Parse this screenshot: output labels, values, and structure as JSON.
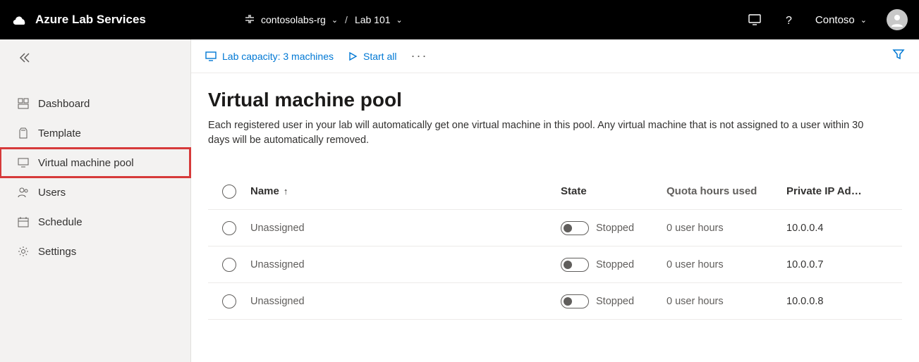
{
  "header": {
    "product": "Azure Lab Services",
    "resource_group": "contosolabs-rg",
    "lab_name": "Lab 101",
    "user_label": "Contoso"
  },
  "sidebar": {
    "items": [
      {
        "id": "dashboard",
        "label": "Dashboard"
      },
      {
        "id": "template",
        "label": "Template"
      },
      {
        "id": "vmpool",
        "label": "Virtual machine pool",
        "selected": true
      },
      {
        "id": "users",
        "label": "Users"
      },
      {
        "id": "schedule",
        "label": "Schedule"
      },
      {
        "id": "settings",
        "label": "Settings"
      }
    ]
  },
  "toolbar": {
    "capacity_label": "Lab capacity: 3 machines",
    "start_all_label": "Start all"
  },
  "page": {
    "title": "Virtual machine pool",
    "description": "Each registered user in your lab will automatically get one virtual machine in this pool. Any virtual machine that is not assigned to a user within 30 days will be automatically removed."
  },
  "table": {
    "columns": {
      "name": "Name",
      "state": "State",
      "quota": "Quota hours used",
      "ip": "Private IP Ad…"
    },
    "rows": [
      {
        "name": "Unassigned",
        "state": "Stopped",
        "quota": "0 user hours",
        "ip": "10.0.0.4"
      },
      {
        "name": "Unassigned",
        "state": "Stopped",
        "quota": "0 user hours",
        "ip": "10.0.0.7"
      },
      {
        "name": "Unassigned",
        "state": "Stopped",
        "quota": "0 user hours",
        "ip": "10.0.0.8"
      }
    ]
  }
}
